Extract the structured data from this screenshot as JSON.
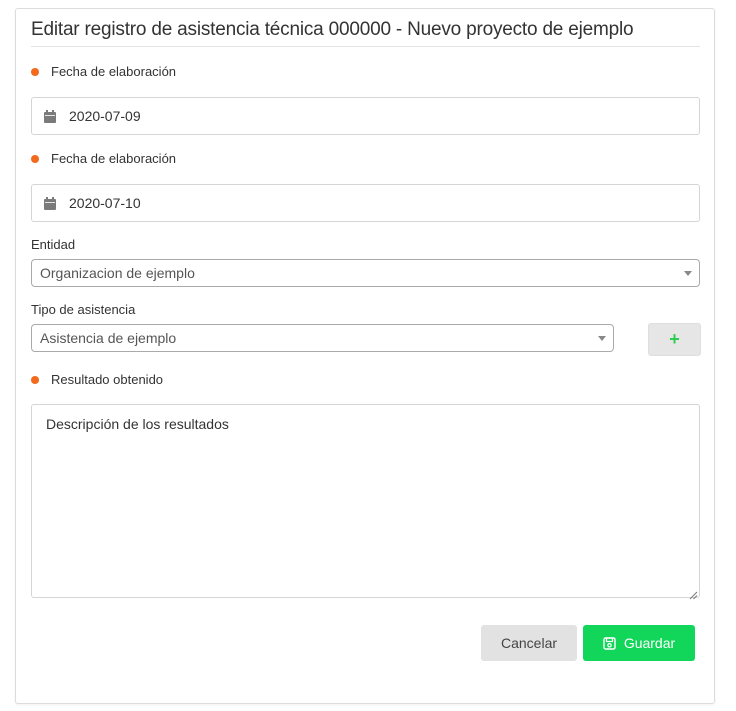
{
  "form": {
    "title": "Editar registro de asistencia técnica 000000 - Nuevo proyecto de ejemplo",
    "fecha1": {
      "label": "Fecha de elaboración",
      "value": "2020-07-09"
    },
    "fecha2": {
      "label": "Fecha de elaboración",
      "value": "2020-07-10"
    },
    "entidad": {
      "label": "Entidad",
      "value": "Organizacion de ejemplo"
    },
    "tipo": {
      "label": "Tipo de asistencia",
      "value": "Asistencia de ejemplo",
      "add_label": "+"
    },
    "resultado": {
      "label": "Resultado obtenido",
      "value": "Descripción de los resultados"
    },
    "actions": {
      "cancel_label": "Cancelar",
      "save_label": "Guardar"
    }
  },
  "icons": {
    "date": "calendar-icon",
    "save": "floppy-disk-icon",
    "dropdown": "caret-down-icon",
    "resize": "resize-handle-icon"
  },
  "colors": {
    "required_dot": "#f26a1b",
    "save_button": "#12d65a",
    "add_plus": "#2ecc52",
    "cancel_button": "#e2e2e2"
  }
}
